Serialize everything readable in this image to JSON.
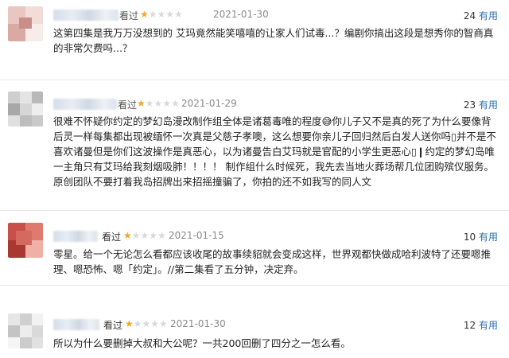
{
  "reviews": [
    {
      "name_suffix": "看过",
      "status": "",
      "stars": "★★★★★",
      "rating": 1,
      "date": "2021-01-30",
      "votes": "24",
      "useful_label": "有用",
      "content": "这第四集是我万万没想到的 艾玛竟然能笑嘻嘻的让家人们试毒...？编剧你搞出这段是想秀你的智商真的非常欠费吗...？",
      "avatar_colors": [
        "#e9c7c0",
        "#f3dcd7",
        "#d9a9a4",
        "#f7ecea"
      ]
    },
    {
      "name_suffix": "看过",
      "status": "",
      "stars": "★★★★★",
      "rating": 1,
      "date": "2021-01-29",
      "votes": "23",
      "useful_label": "有用",
      "content": "很难不怀疑你约定的梦幻岛漫改制作组全体是诸葛毒唯的程度😅你儿子又不是真的死了为什么要像背后灵一样每集都出现被缅怀一次真是父慈子孝噢，这么想要你亲儿子回归然后白发人送你吗▯并不是不喜欢诸曼但是你们这波操作是真恶心，以为诸曼告白艾玛就是官配的小学生更恶心▯❙约定的梦幻岛唯一主角只有艾玛给我刻烟吸肺！！！！ 制作组什么时候死，我先去当地火葬场帮几位团购殡仪服务。 原创团队不要打着我岛招牌出来招摇撞骗了，你拍的还不如我写的同人文",
      "avatar_colors": [
        "#cfcfcf",
        "#b9b9b9",
        "#e4e4e4",
        "#a8a8a8"
      ]
    },
    {
      "name_suffix": "",
      "status": "看过",
      "stars": "★★★★★",
      "rating": 1,
      "date": "2021-01-15",
      "votes": "10",
      "useful_label": "有用",
      "content": "零星。给一个无论怎么看都应该收尾的故事续貂就会变成这样，世界观都快做成哈利波特了还要嗯推理、嗯恐怖、嗯「约定」。//第二集看了五分钟，决定弃。",
      "avatar_colors": [
        "#c9504a",
        "#e07a6e",
        "#a83830",
        "#f0b0a6"
      ]
    },
    {
      "name_suffix": "",
      "status": "看过",
      "stars": "★★★★★",
      "rating": 1,
      "date": "2021-01-30",
      "votes": "12",
      "useful_label": "有用",
      "content": "所以为什么要删掉大叔和大公呢？一共200回删了四分之一怎么看。",
      "avatar_colors": [
        "#e6e6e6",
        "#d0d0d0",
        "#f2f2f2",
        "#c4c4c4"
      ]
    }
  ]
}
